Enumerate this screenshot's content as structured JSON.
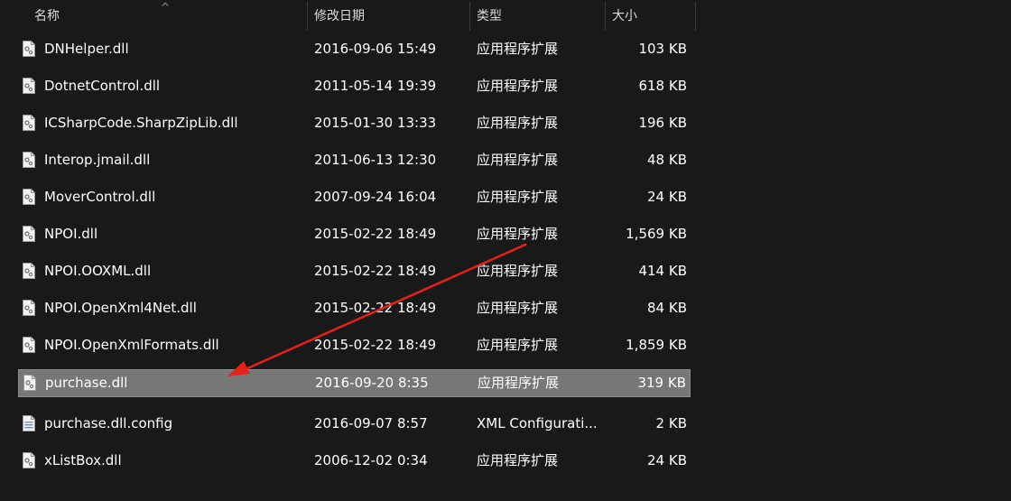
{
  "header": {
    "name": "名称",
    "date": "修改日期",
    "type": "类型",
    "size": "大小",
    "sort_indicator": "^"
  },
  "files": [
    {
      "name": "DNHelper.dll",
      "date": "2016-09-06 15:49",
      "type": "应用程序扩展",
      "size": "103 KB",
      "icon": "dll-icon"
    },
    {
      "name": "DotnetControl.dll",
      "date": "2011-05-14 19:39",
      "type": "应用程序扩展",
      "size": "618 KB",
      "icon": "dll-icon"
    },
    {
      "name": "ICSharpCode.SharpZipLib.dll",
      "date": "2015-01-30 13:33",
      "type": "应用程序扩展",
      "size": "196 KB",
      "icon": "dll-icon"
    },
    {
      "name": "Interop.jmail.dll",
      "date": "2011-06-13 12:30",
      "type": "应用程序扩展",
      "size": "48 KB",
      "icon": "dll-icon"
    },
    {
      "name": "MoverControl.dll",
      "date": "2007-09-24 16:04",
      "type": "应用程序扩展",
      "size": "24 KB",
      "icon": "dll-icon"
    },
    {
      "name": "NPOI.dll",
      "date": "2015-02-22 18:49",
      "type": "应用程序扩展",
      "size": "1,569 KB",
      "icon": "dll-icon"
    },
    {
      "name": "NPOI.OOXML.dll",
      "date": "2015-02-22 18:49",
      "type": "应用程序扩展",
      "size": "414 KB",
      "icon": "dll-icon"
    },
    {
      "name": "NPOI.OpenXml4Net.dll",
      "date": "2015-02-22 18:49",
      "type": "应用程序扩展",
      "size": "84 KB",
      "icon": "dll-icon"
    },
    {
      "name": "NPOI.OpenXmlFormats.dll",
      "date": "2015-02-22 18:49",
      "type": "应用程序扩展",
      "size": "1,859 KB",
      "icon": "dll-icon"
    },
    {
      "name": "purchase.dll",
      "date": "2016-09-20 8:35",
      "type": "应用程序扩展",
      "size": "319 KB",
      "icon": "dll-icon",
      "selected": true
    },
    {
      "name": "purchase.dll.config",
      "date": "2016-09-07 8:57",
      "type": "XML Configurati...",
      "size": "2 KB",
      "icon": "config-icon"
    },
    {
      "name": "xListBox.dll",
      "date": "2006-12-02 0:34",
      "type": "应用程序扩展",
      "size": "24 KB",
      "icon": "dll-icon"
    }
  ],
  "colors": {
    "background": "#191919",
    "selection": "#777777",
    "annotation_arrow": "#e8201c"
  }
}
